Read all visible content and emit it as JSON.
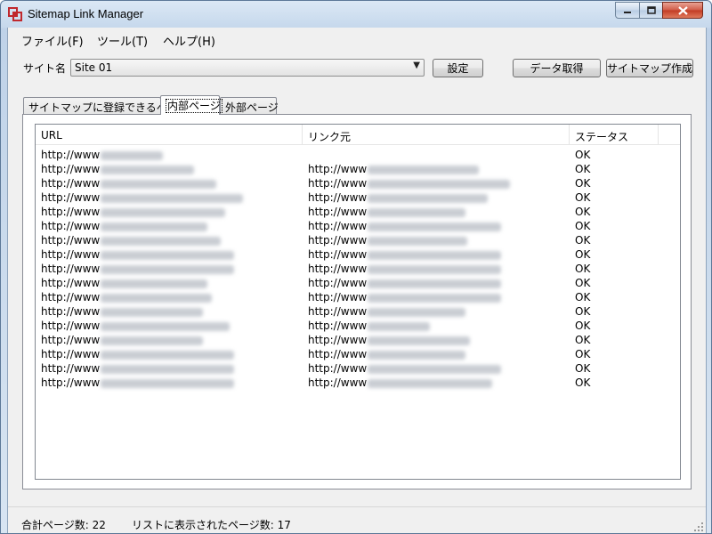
{
  "window": {
    "title": "Sitemap Link Manager"
  },
  "menu": [
    "ファイル(F)",
    "ツール(T)",
    "ヘルプ(H)"
  ],
  "site": {
    "label": "サイト名 :",
    "selected": "Site 01"
  },
  "buttons": {
    "settings": "設定",
    "fetch": "データ取得",
    "create_sitemap": "サイトマップ作成"
  },
  "tabs": [
    {
      "label": "サイトマップに登録できるページ",
      "active": false
    },
    {
      "label": "内部ページ",
      "active": true
    },
    {
      "label": "外部ページ",
      "active": false
    }
  ],
  "table": {
    "columns": [
      "URL",
      "リンク元",
      "ステータス"
    ],
    "rows": [
      {
        "url": "http://www",
        "source": "",
        "status": "OK"
      },
      {
        "url": "http://www",
        "source": "http://www",
        "status": "OK"
      },
      {
        "url": "http://www",
        "source": "http://www",
        "status": "OK"
      },
      {
        "url": "http://www",
        "source": "http://www",
        "status": "OK"
      },
      {
        "url": "http://www",
        "source": "http://www",
        "status": "OK"
      },
      {
        "url": "http://www",
        "source": "http://www",
        "status": "OK"
      },
      {
        "url": "http://www",
        "source": "http://www",
        "status": "OK"
      },
      {
        "url": "http://www",
        "source": "http://www",
        "status": "OK"
      },
      {
        "url": "http://www",
        "source": "http://www",
        "status": "OK"
      },
      {
        "url": "http://www",
        "source": "http://www",
        "status": "OK"
      },
      {
        "url": "http://www",
        "source": "http://www",
        "status": "OK"
      },
      {
        "url": "http://www",
        "source": "http://www",
        "status": "OK"
      },
      {
        "url": "http://www",
        "source": "http://www",
        "status": "OK"
      },
      {
        "url": "http://www",
        "source": "http://www",
        "status": "OK"
      },
      {
        "url": "http://www",
        "source": "http://www",
        "status": "OK"
      },
      {
        "url": "http://www",
        "source": "http://www",
        "status": "OK"
      },
      {
        "url": "http://www",
        "source": "http://www",
        "status": "OK"
      }
    ]
  },
  "status": {
    "total": "合計ページ数: 22",
    "listed": "リストに表示されたページ数: 17"
  },
  "colors": {
    "title_bar": "#c6d8ec",
    "close_button": "#c23b23",
    "border": "#5c7898"
  },
  "icons": {
    "app": "app-logo-icon",
    "minimize": "minimize-icon",
    "maximize": "maximize-icon",
    "close": "close-icon",
    "dropdown": "chevron-down-icon",
    "resize": "resize-grip-icon"
  }
}
